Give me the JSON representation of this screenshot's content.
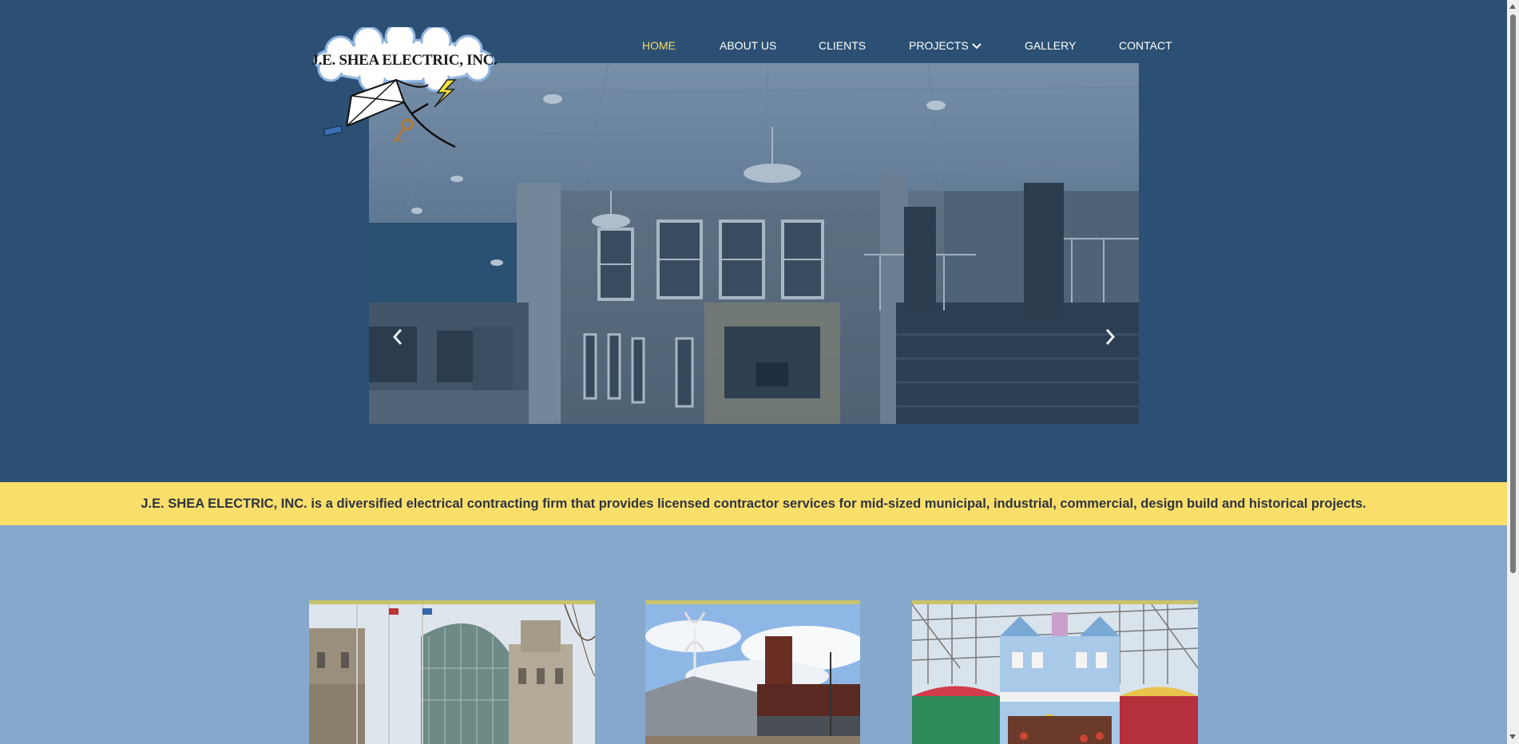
{
  "logo": {
    "text": "J.E. SHEA ELECTRIC, INC.",
    "icon": "kite-key-lightning-logo"
  },
  "nav": {
    "items": [
      {
        "label": "HOME",
        "active": true
      },
      {
        "label": "ABOUT US",
        "active": false
      },
      {
        "label": "CLIENTS",
        "active": false
      },
      {
        "label": "PROJECTS",
        "active": false,
        "has_dropdown": true
      },
      {
        "label": "GALLERY",
        "active": false
      },
      {
        "label": "CONTACT",
        "active": false
      }
    ]
  },
  "slider": {
    "prev_icon": "chevron-left-icon",
    "next_icon": "chevron-right-icon"
  },
  "tagline": "J.E. SHEA ELECTRIC, INC. is a diversified electrical contracting firm that provides licensed contractor services for mid-sized municipal, industrial, commercial, design build and historical projects.",
  "colors": {
    "hero_bg": "#2b5073",
    "body_bg": "#86a8cc",
    "accent_yellow": "#fbdf6b",
    "nav_active": "#f5d86a",
    "nav_text": "#ffffff"
  }
}
